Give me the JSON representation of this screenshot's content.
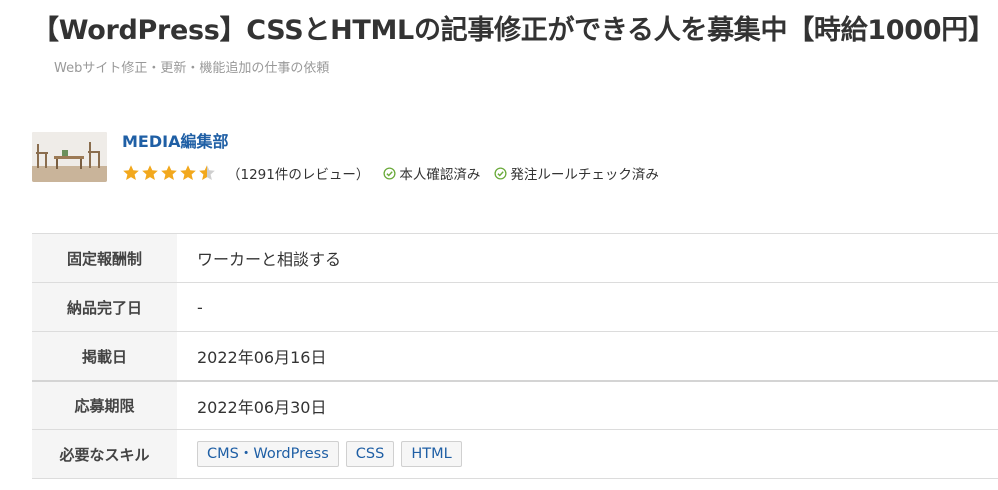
{
  "job": {
    "title": "【WordPress】CSSとHTMLの記事修正ができる人を募集中【時給1000円】",
    "category": "Webサイト修正・更新・機能追加の仕事の依頼"
  },
  "client": {
    "name": "MEDIA編集部",
    "rating": 4.5,
    "reviews": "（1291件のレビュー）",
    "badges": [
      "本人確認済み",
      "発注ルールチェック済み"
    ]
  },
  "details": {
    "rows": [
      {
        "label": "固定報酬制",
        "value": "ワーカーと相談する"
      },
      {
        "label": "納品完了日",
        "value": "-"
      },
      {
        "label": "掲載日",
        "value": "2022年06月16日"
      },
      {
        "label": "応募期限",
        "value": "2022年06月30日"
      }
    ],
    "skills_label": "必要なスキル",
    "skills": [
      "CMS・WordPress",
      "CSS",
      "HTML"
    ]
  },
  "colors": {
    "accent": "#1f5fa5",
    "star": "#f2a81d",
    "check": "#6aaa3a"
  }
}
